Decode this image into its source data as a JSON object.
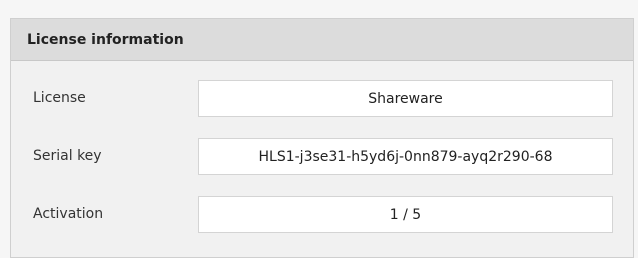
{
  "panel": {
    "title": "License information",
    "rows": [
      {
        "label": "License",
        "value": "Shareware"
      },
      {
        "label": "Serial key",
        "value": "HLS1-j3se31-h5yd6j-0nn879-ayq2r290-68"
      },
      {
        "label": "Activation",
        "value": "1 / 5"
      }
    ]
  }
}
